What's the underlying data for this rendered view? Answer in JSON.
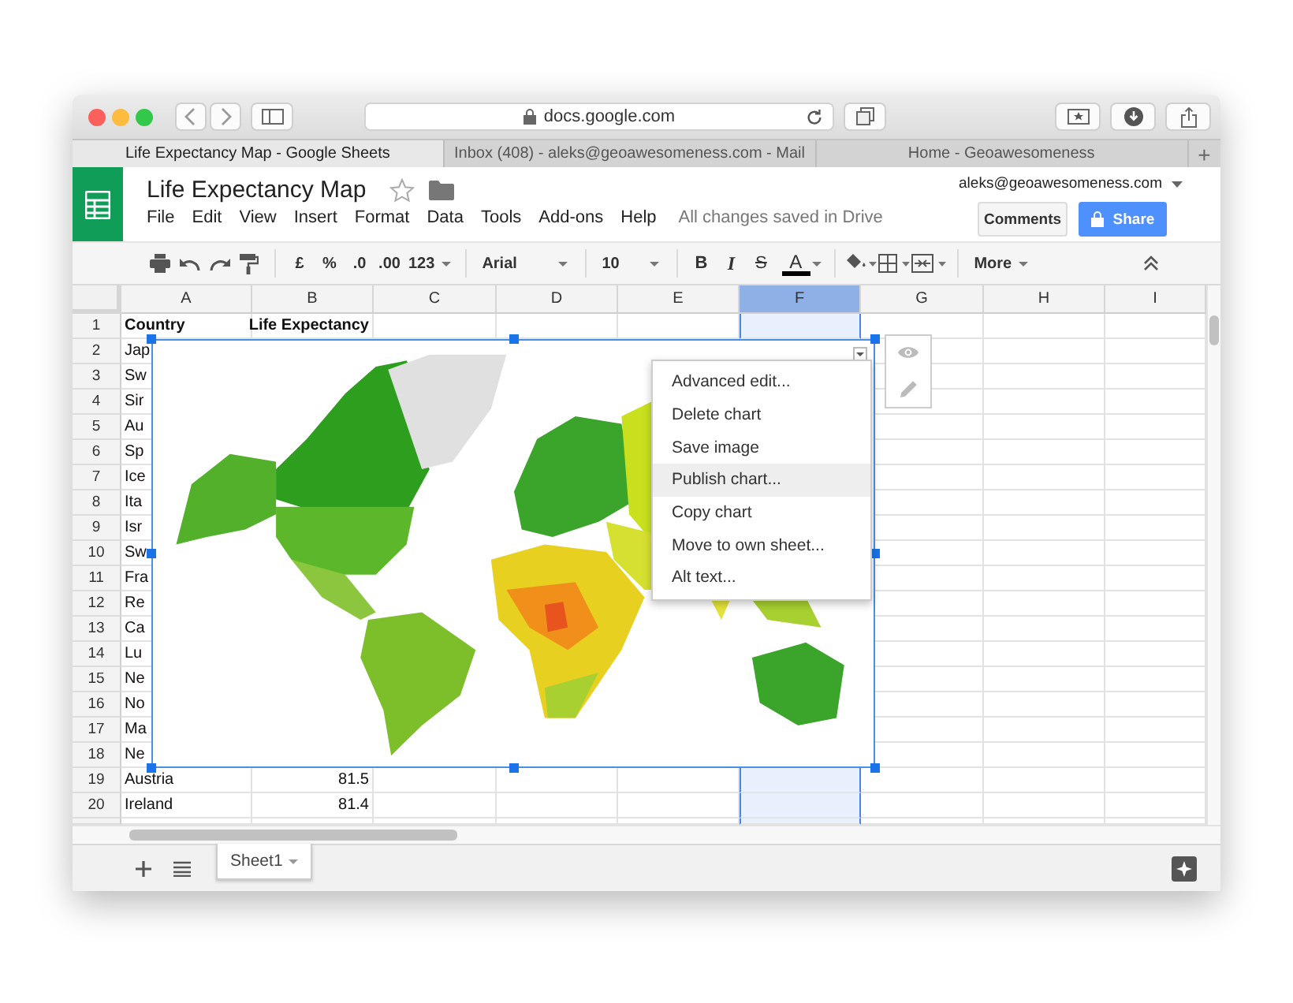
{
  "browser": {
    "url": "docs.google.com",
    "tabs": [
      {
        "label": "Life Expectancy Map - Google Sheets",
        "selected": true
      },
      {
        "label": "Inbox (408) - aleks@geoawesomeness.com - Mail",
        "selected": false
      },
      {
        "label": "Home - Geoawesomeness",
        "selected": false
      }
    ],
    "new_tab": "+"
  },
  "doc": {
    "title": "Life Expectancy Map",
    "starred": false,
    "menu": [
      "File",
      "Edit",
      "View",
      "Insert",
      "Format",
      "Data",
      "Tools",
      "Add-ons",
      "Help"
    ],
    "save_status": "All changes saved in Drive",
    "account": "aleks@geoawesomeness.com",
    "comments_button": "Comments",
    "share_button": "Share"
  },
  "toolbar": {
    "currency": "£",
    "percent": "%",
    "decrease_decimals": ".0",
    "increase_decimals": ".00",
    "number_format": "123",
    "font": "Arial",
    "font_size": "10",
    "bold": "B",
    "italic": "I",
    "strikethrough": "S",
    "text_color": "A",
    "more": "More"
  },
  "sheet": {
    "columns": [
      {
        "label": "A",
        "selected": false
      },
      {
        "label": "B",
        "selected": false
      },
      {
        "label": "C",
        "selected": false
      },
      {
        "label": "D",
        "selected": false
      },
      {
        "label": "E",
        "selected": false
      },
      {
        "label": "F",
        "selected": true
      },
      {
        "label": "G",
        "selected": false
      },
      {
        "label": "H",
        "selected": false
      },
      {
        "label": "I",
        "selected": false
      }
    ],
    "rows": [
      {
        "number": "1",
        "bold": true,
        "cells": [
          "Country",
          "Life Expectancy"
        ]
      },
      {
        "number": "2",
        "bold": false,
        "cells": [
          "Jap"
        ]
      },
      {
        "number": "3",
        "bold": false,
        "cells": [
          "Sw"
        ]
      },
      {
        "number": "4",
        "bold": false,
        "cells": [
          "Sir"
        ]
      },
      {
        "number": "5",
        "bold": false,
        "cells": [
          "Au"
        ]
      },
      {
        "number": "6",
        "bold": false,
        "cells": [
          "Sp"
        ]
      },
      {
        "number": "7",
        "bold": false,
        "cells": [
          "Ice"
        ]
      },
      {
        "number": "8",
        "bold": false,
        "cells": [
          "Ita"
        ]
      },
      {
        "number": "9",
        "bold": false,
        "cells": [
          "Isr"
        ]
      },
      {
        "number": "10",
        "bold": false,
        "cells": [
          "Sw"
        ]
      },
      {
        "number": "11",
        "bold": false,
        "cells": [
          "Fra"
        ]
      },
      {
        "number": "12",
        "bold": false,
        "cells": [
          "Re"
        ]
      },
      {
        "number": "13",
        "bold": false,
        "cells": [
          "Ca"
        ]
      },
      {
        "number": "14",
        "bold": false,
        "cells": [
          "Lu"
        ]
      },
      {
        "number": "15",
        "bold": false,
        "cells": [
          "Ne"
        ]
      },
      {
        "number": "16",
        "bold": false,
        "cells": [
          "No"
        ]
      },
      {
        "number": "17",
        "bold": false,
        "cells": [
          "Ma"
        ]
      },
      {
        "number": "18",
        "bold": false,
        "cells": [
          "Ne"
        ]
      },
      {
        "number": "19",
        "bold": false,
        "cells": [
          "Austria",
          "81.5"
        ]
      },
      {
        "number": "20",
        "bold": false,
        "cells": [
          "Ireland",
          "81.4"
        ]
      }
    ]
  },
  "chart": {
    "menu": [
      {
        "label": "Advanced edit...",
        "selected": false
      },
      {
        "label": "Delete chart",
        "selected": false
      },
      {
        "label": "Save image",
        "selected": false
      },
      {
        "label": "Publish chart...",
        "selected": true
      },
      {
        "label": "Copy chart",
        "selected": false
      },
      {
        "label": "Move to own sheet...",
        "selected": false
      },
      {
        "label": "Alt text...",
        "selected": false
      }
    ]
  },
  "sheet_tabs": [
    {
      "label": "Sheet1",
      "selected": true
    }
  ]
}
